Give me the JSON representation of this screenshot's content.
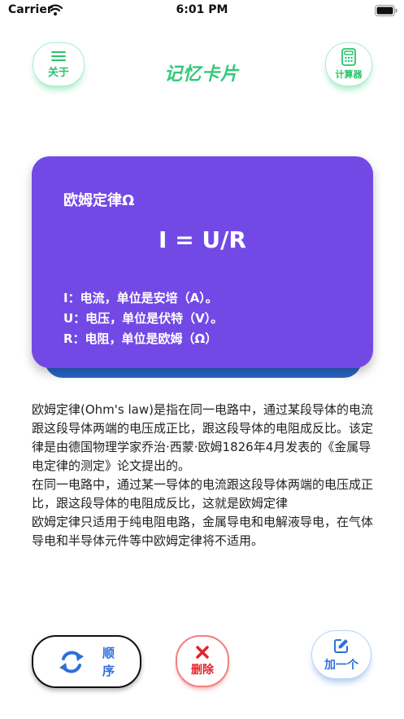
{
  "status_bar": {
    "carrier": "Carrier",
    "time": "6:01 PM"
  },
  "header": {
    "about_label": "关于",
    "title": "记忆卡片",
    "calculator_label": "计算器"
  },
  "card": {
    "title": "欧姆定律Ω",
    "formula": "I = U/R",
    "notes": [
      "I：电流，单位是安培（A）。",
      "U：电压，单位是伏特（V）。",
      "R：电阻，单位是欧姆（Ω）"
    ]
  },
  "description": {
    "paragraphs": [
      "欧姆定律(Ohm's law)是指在同一电路中，通过某段导体的电流跟这段导体两端的电压成正比，跟这段导体的电阻成反比。该定律是由德国物理学家乔治·西蒙·欧姆1826年4月发表的《金属导电定律的测定》论文提出的。",
      "在同一电路中，通过某一导体的电流跟这段导体两端的电压成正比，跟这段导体的电阻成反比，这就是欧姆定律",
      "欧姆定律只适用于纯电阻电路，金属导电和电解液导电，在气体导电和半导体元件等中欧姆定律将不适用。"
    ]
  },
  "bottom_bar": {
    "order_label": "顺序",
    "delete_label": "删除",
    "add_label": "加一个"
  },
  "colors": {
    "card_background": "#7349e6",
    "card_shadow_layer": "#2966c8",
    "accent_green": "#32c97a",
    "accent_blue": "#2e6fdc",
    "delete_red": "#e2242a"
  },
  "icons": {
    "about": "menu-lines-icon",
    "calculator": "calculator-icon",
    "order": "refresh-icon",
    "delete": "close-x-icon",
    "add": "edit-icon"
  }
}
